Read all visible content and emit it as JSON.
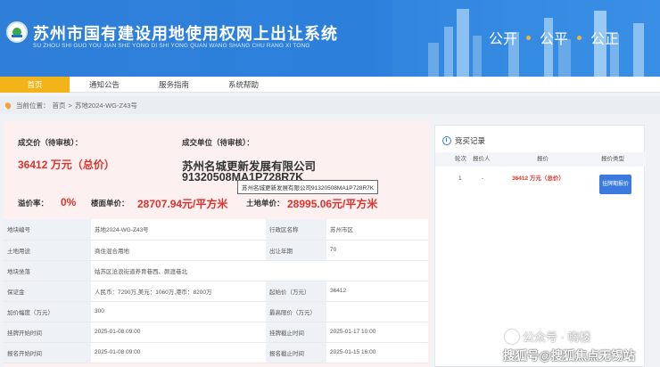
{
  "header": {
    "title_cn": "苏州市国有建设用地使用权网上出让系统",
    "title_en": "SU ZHOU SHI GUO YOU JIAN SHE YONG DI SHI YONG QUAN WANG SHANG CHU RANG XI TONG",
    "slogan": [
      "公开",
      "公平",
      "公正"
    ]
  },
  "nav": {
    "items": [
      {
        "label": "首页",
        "active": true
      },
      {
        "label": "通知公告",
        "active": false
      },
      {
        "label": "服务指南",
        "active": false
      },
      {
        "label": "系统帮助",
        "active": false
      }
    ]
  },
  "breadcrumb": {
    "prefix": "当前位置：",
    "home": "首页",
    "sep": ">",
    "current": "苏地2024-WG-Z43号"
  },
  "deal": {
    "price_label": "成交价（待审核）：",
    "price_value": "36412 万元（总价）",
    "unit_label": "成交单位（待审核）：",
    "company": "苏州名城更新发展有限公司",
    "company_code": "91320508MA1P728R7K",
    "tooltip": "苏州名城更新发展有限公司91320508MA1P728R7K",
    "premium_label": "溢价率：",
    "premium_value": "0%",
    "floor_price_label": "楼面单价：",
    "floor_price_value": "28707.94元/平方米",
    "land_price_label": "土地单价：",
    "land_price_value": "28995.06元/平方米"
  },
  "info_rows": [
    [
      "地块编号",
      "苏地2024-WG-Z43号",
      "行政区名称",
      "苏州市区"
    ],
    [
      "土地用途",
      "商住混合用地",
      "出让年期",
      "70"
    ],
    [
      "地块坐落",
      "姑苏区沧浪街道养育巷西、颜渡巷北",
      "",
      ""
    ],
    [
      "保证金",
      "人民币：7290万,美元：1060万,港币：8200万",
      "起始价（万元）",
      "36412"
    ],
    [
      "加价幅度（万元）",
      "300",
      "最高限价（万元）",
      ""
    ],
    [
      "挂牌开始时间",
      "2025-01-08 09:00",
      "挂牌截止时间",
      "2025-01-17 10:00"
    ],
    [
      "报名开始时间",
      "2025-01-08 09:00",
      "报名截止时间",
      "2025-01-15 16:00"
    ]
  ],
  "records": {
    "title": "竞买记录",
    "headers": [
      "轮次",
      "报价人",
      "报价",
      "报价类型"
    ],
    "rows": [
      {
        "round": "1",
        "bidder": "-",
        "price": "36412 万元（总价）",
        "type": "挂牌期报价"
      }
    ]
  },
  "watermark": {
    "line1": "公众号 · 嗨楼",
    "line2": "搜狐号@搜狐焦点无锡站"
  },
  "colors": {
    "header_blue": "#2c80dc",
    "nav_active": "#f2b418",
    "price_red": "#e0322c",
    "badge_blue": "#3b7be0"
  }
}
